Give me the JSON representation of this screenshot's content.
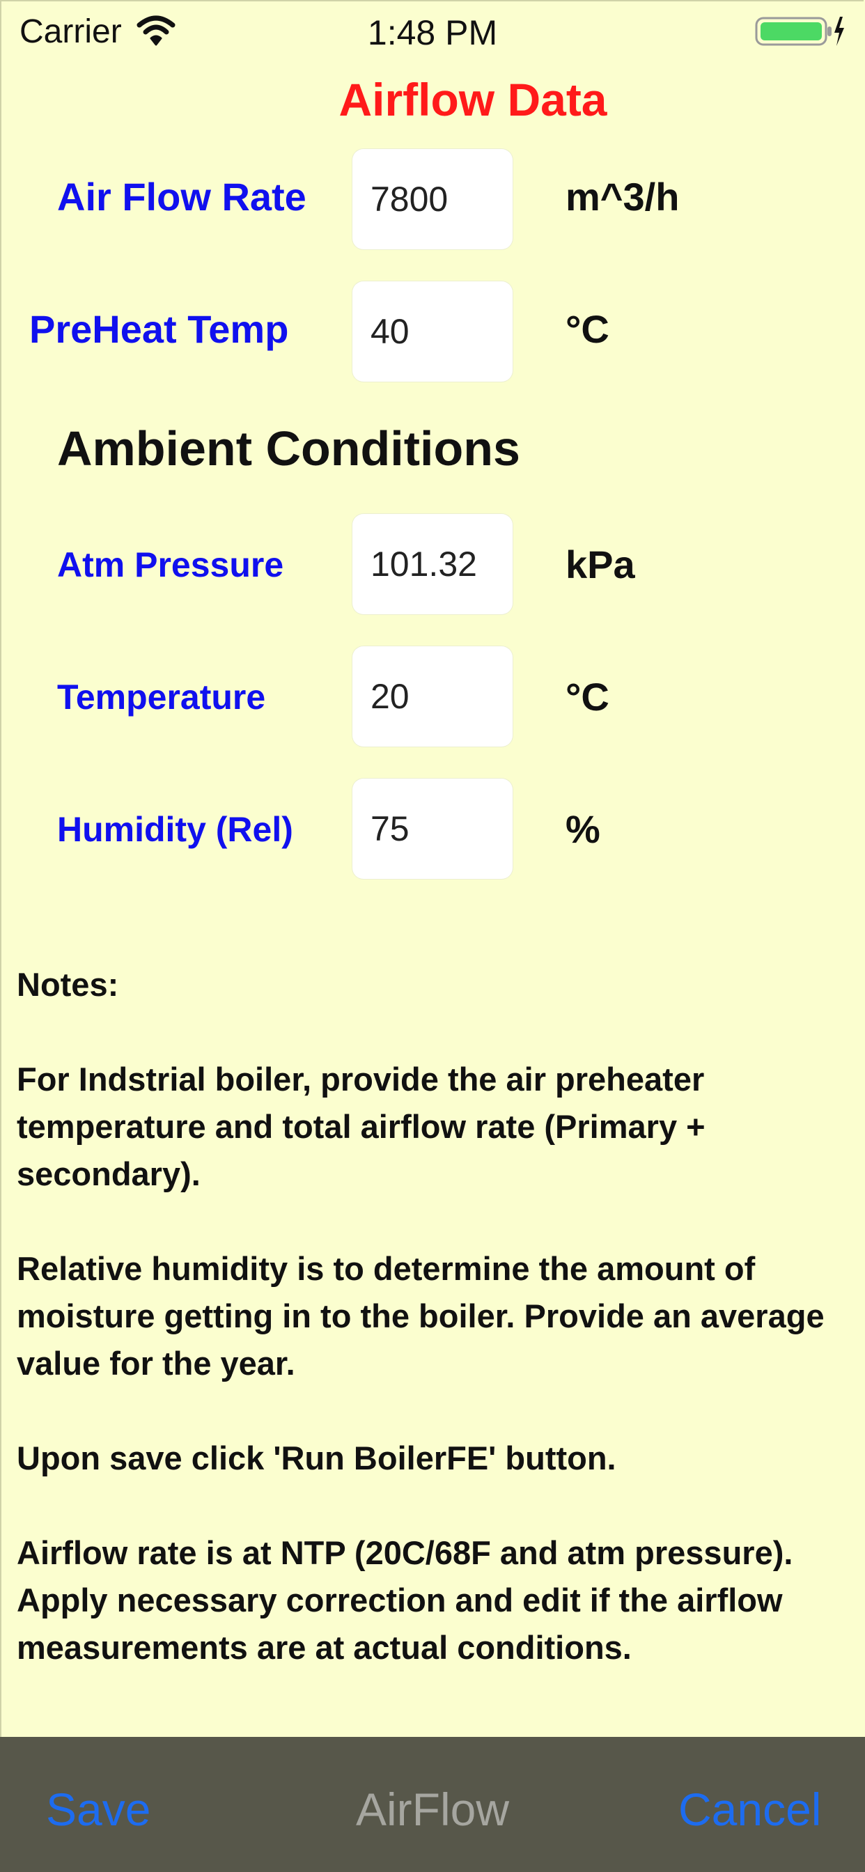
{
  "status_bar": {
    "carrier": "Carrier",
    "time": "1:48 PM",
    "wifi_icon": "wifi-icon",
    "battery_icon": "battery-charging-icon",
    "battery_color": "#4cd964"
  },
  "title": "Airflow Data",
  "rows": [
    {
      "label": "Air Flow Rate",
      "value": "7800",
      "unit": "m^3/h"
    },
    {
      "label": "PreHeat Temp",
      "value": "40",
      "unit": "°C"
    }
  ],
  "ambient": {
    "heading": "Ambient Conditions",
    "rows": [
      {
        "label": "Atm Pressure",
        "value": "101.32",
        "unit": "kPa"
      },
      {
        "label": "Temperature",
        "value": "20",
        "unit": "°C"
      },
      {
        "label": "Humidity (Rel)",
        "value": "75",
        "unit": "%"
      }
    ]
  },
  "notes": {
    "heading": "Notes:",
    "paragraphs": [
      "For Indstrial boiler, provide the air preheater temperature and total airflow rate (Primary + secondary).",
      "Relative humidity is to determine the amount of moisture getting in to the boiler.  Provide an average value for the year.",
      "Upon save click 'Run BoilerFE' button.",
      "Airflow rate is at NTP (20C/68F and atm pressure). Apply necessary correction and edit if the airflow measurements are at actual conditions."
    ]
  },
  "toolbar": {
    "save_label": "Save",
    "title": "AirFlow",
    "cancel_label": "Cancel"
  },
  "colors": {
    "background": "#fbfecf",
    "title": "#ff1a1a",
    "label": "#1010ee",
    "toolbar_bg": "#57574a",
    "toolbar_button": "#1d6cf0"
  }
}
